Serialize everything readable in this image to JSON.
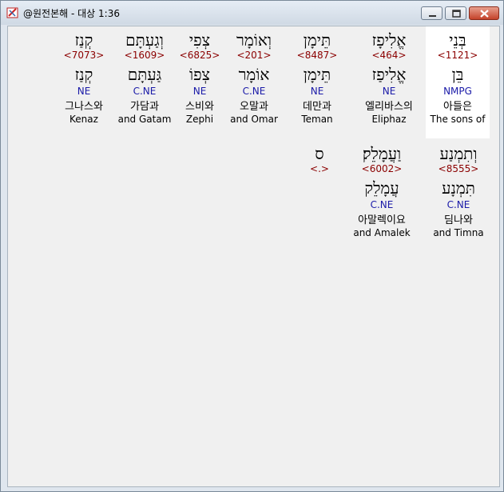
{
  "window": {
    "title": "@원전본해 - 대상 1:36"
  },
  "rows": [
    {
      "words": [
        {
          "heb": "בְּנֵי",
          "strong": "<1121>",
          "lemma": "בֵּן",
          "morph": "NMPG",
          "kor": "아들은",
          "eng": "The sons of",
          "highlight": true
        },
        {
          "heb": "אֱלִיפָז",
          "strong": "<464>",
          "lemma": "אֱלִיפַז",
          "morph": "NE",
          "kor": "엘리바스의",
          "eng": "Eliphaz",
          "highlight": false
        },
        {
          "heb": "תֵּימָן",
          "strong": "<8487>",
          "lemma": "תֵּימָן",
          "morph": "NE",
          "kor": "데만과",
          "eng": "Teman",
          "highlight": false
        },
        {
          "heb": "וְאוֹמָר",
          "strong": "<201>",
          "lemma": "אוֹמָר",
          "morph": "C.NE",
          "kor": "오말과",
          "eng": "and Omar",
          "highlight": false
        },
        {
          "heb": "צְפִי",
          "strong": "<6825>",
          "lemma": "צְפוֹ",
          "morph": "NE",
          "kor": "스비와",
          "eng": "Zephi",
          "highlight": false
        },
        {
          "heb": "וְגַעְתָּם",
          "strong": "<1609>",
          "lemma": "גַּעְתָּם",
          "morph": "C.NE",
          "kor": "가담과",
          "eng": "and Gatam",
          "highlight": false
        },
        {
          "heb": "קְנַז",
          "strong": "<7073>",
          "lemma": "קְנַז",
          "morph": "NE",
          "kor": "그나스와",
          "eng": "Kenaz",
          "highlight": false
        }
      ]
    },
    {
      "words": [
        {
          "heb": "וְתִמְנַע",
          "strong": "<8555>",
          "lemma": "תִּמְנָע",
          "morph": "C.NE",
          "kor": "딤나와",
          "eng": "and Timna",
          "highlight": false
        },
        {
          "heb": "וַעֲמָלֵק׃",
          "strong": "<6002>",
          "lemma": "עֲמָלֵק",
          "morph": "C.NE",
          "kor": "아말렉이요",
          "eng": "and Amalek",
          "highlight": false
        },
        {
          "heb": "ס",
          "strong": "<.>",
          "lemma": "",
          "morph": "",
          "kor": "",
          "eng": "",
          "highlight": false
        }
      ]
    }
  ]
}
